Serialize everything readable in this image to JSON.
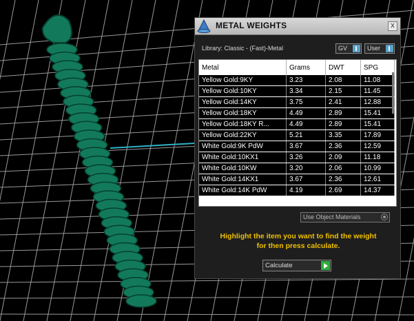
{
  "panel": {
    "title": "METAL WEIGHTS",
    "close_label": "x",
    "library_label": "Library: Classic - (Fast)-Metal",
    "gv_dropdown": "GV",
    "user_dropdown": "User",
    "use_object_materials": "Use Object Materials",
    "instructions_line1": "Highlight the item you want to find the weight",
    "instructions_line2": "for then press calculate.",
    "calculate_label": "Calculate"
  },
  "table": {
    "headers": [
      "Metal",
      "Grams",
      "DWT",
      "SPG"
    ],
    "rows": [
      [
        "Yellow Gold:9KY",
        "3.23",
        "2.08",
        "11.08"
      ],
      [
        "Yellow Gold:10KY",
        "3.34",
        "2.15",
        "11.45"
      ],
      [
        "Yellow Gold:14KY",
        "3.75",
        "2.41",
        "12.88"
      ],
      [
        "Yellow Gold:18KY",
        "4.49",
        "2.89",
        "15.41"
      ],
      [
        "Yellow Gold:18KY R...",
        "4.49",
        "2.89",
        "15.41"
      ],
      [
        "Yellow Gold:22KY",
        "5.21",
        "3.35",
        "17.89"
      ],
      [
        "White Gold:9K PdW",
        "3.67",
        "2.36",
        "12.59"
      ],
      [
        "White Gold:10KX1",
        "3.26",
        "2.09",
        "11.18"
      ],
      [
        "White Gold:10KW",
        "3.20",
        "2.06",
        "10.99"
      ],
      [
        "White Gold:14KX1",
        "3.67",
        "2.36",
        "12.61"
      ],
      [
        "White Gold:14K PdW",
        "4.19",
        "2.69",
        "14.37"
      ]
    ]
  },
  "colors": {
    "pendant": "#127a5a",
    "grid": "#9a9a9a",
    "instructions": "#f0c000",
    "accent": "#5aa0c8"
  }
}
